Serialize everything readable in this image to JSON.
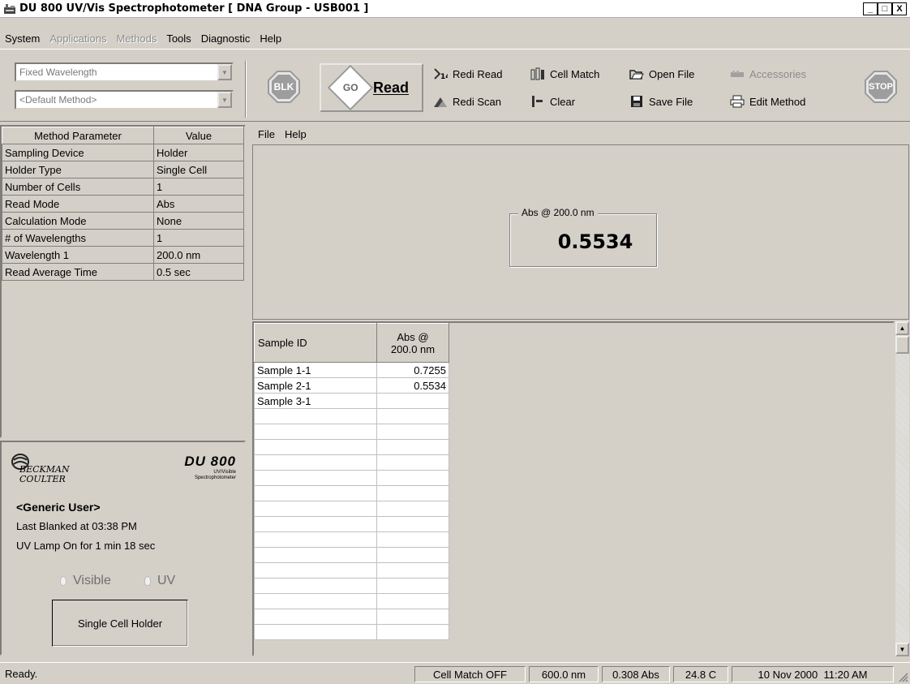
{
  "window": {
    "title": "DU 800 UV/Vis Spectrophotometer [ DNA Group - USB001 ]",
    "minimize": "_",
    "maximize": "□",
    "close": "X"
  },
  "menu": [
    {
      "label": "System",
      "enabled": true
    },
    {
      "label": "Applications",
      "enabled": false
    },
    {
      "label": "Methods",
      "enabled": false
    },
    {
      "label": "Tools",
      "enabled": true
    },
    {
      "label": "Diagnostic",
      "enabled": true
    },
    {
      "label": "Help",
      "enabled": true
    }
  ],
  "toolbar": {
    "mode_combo": "Fixed Wavelength",
    "method_combo": "<Default Method>",
    "blk_label": "BLK",
    "go_label": "GO",
    "read_label": "Read",
    "redi_read": "Redi Read",
    "redi_scan": "Redi Scan",
    "cell_match": "Cell Match",
    "clear": "Clear",
    "open_file": "Open File",
    "save_file": "Save File",
    "accessories": "Accessories",
    "edit_method": "Edit Method",
    "stop_label": "STOP"
  },
  "params": {
    "headers": [
      "Method Parameter",
      "Value"
    ],
    "rows": [
      {
        "name": "Sampling Device",
        "value": "Holder"
      },
      {
        "name": "Holder Type",
        "value": "Single Cell"
      },
      {
        "name": "Number of Cells",
        "value": "1"
      },
      {
        "name": "Read Mode",
        "value": "Abs"
      },
      {
        "name": "Calculation Mode",
        "value": "None"
      },
      {
        "name": "# of Wavelengths",
        "value": "1"
      },
      {
        "name": "Wavelength 1",
        "value": "200.0 nm"
      },
      {
        "name": "Read Average Time",
        "value": "0.5 sec"
      }
    ]
  },
  "info": {
    "brand_line1": "BECKMAN",
    "brand_line2": "COULTER",
    "product": "DU 800",
    "product_sub1": "UV/Visible",
    "product_sub2": "Spectrophotometer",
    "user": "<Generic User>",
    "last_blanked": "Last Blanked at 03:38 PM",
    "uv_lamp": "UV Lamp On for 1 min 18 sec",
    "lamp_visible": "Visible",
    "lamp_uv": "UV",
    "holder": "Single Cell Holder"
  },
  "right_menu": [
    "File",
    "Help"
  ],
  "readout": {
    "caption": "Abs @ 200.0 nm",
    "value": "0.5534"
  },
  "results": {
    "col1": "Sample ID",
    "col2_line1": "Abs @",
    "col2_line2": "200.0 nm",
    "rows": [
      {
        "id": "Sample 1-1",
        "abs": "0.7255"
      },
      {
        "id": "Sample 2-1",
        "abs": "0.5534"
      },
      {
        "id": "Sample 3-1",
        "abs": ""
      }
    ],
    "empty_rows": 15
  },
  "status": {
    "text": "Ready.",
    "cell_match": "Cell Match OFF",
    "wavelength": "600.0 nm",
    "abs": "0.308 Abs",
    "temp": "24.8 C",
    "datetime": "10 Nov 2000  11:20 AM"
  }
}
